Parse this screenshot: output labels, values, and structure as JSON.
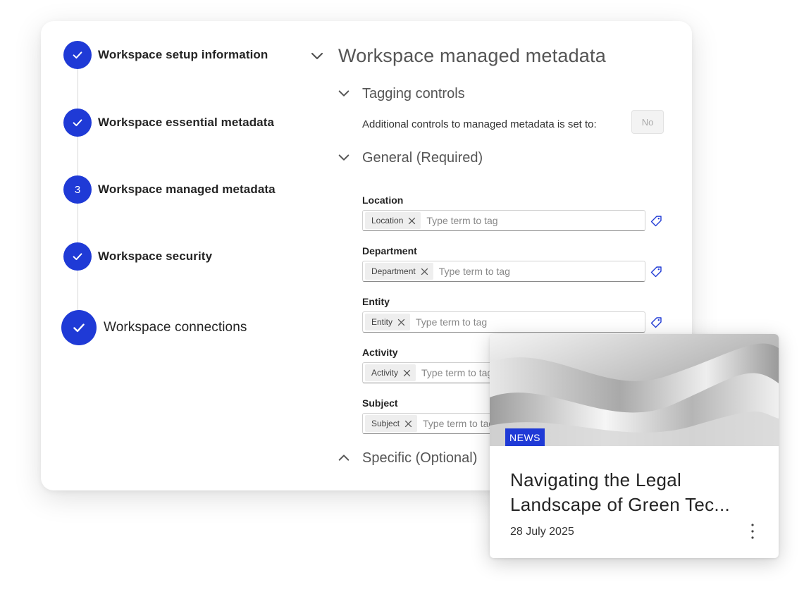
{
  "stepper": {
    "steps": [
      {
        "label": "Workspace setup information",
        "state": "complete",
        "icon": "check-icon"
      },
      {
        "label": "Workspace essential metadata",
        "state": "complete",
        "icon": "check-icon"
      },
      {
        "label": "Workspace managed metadata",
        "state": "current",
        "number": "3"
      },
      {
        "label": "Workspace security",
        "state": "complete",
        "icon": "check-icon"
      },
      {
        "label": "Workspace connections",
        "state": "complete",
        "icon": "check-icon"
      }
    ]
  },
  "main": {
    "title": "Workspace managed metadata",
    "tagging": {
      "heading": "Tagging controls",
      "description": "Additional controls to managed metadata is set to:",
      "toggle_value": "No"
    },
    "general": {
      "heading": "General (Required)",
      "fields": [
        {
          "label": "Location",
          "chip": "Location",
          "placeholder": "Type term to tag"
        },
        {
          "label": "Department",
          "chip": "Department",
          "placeholder": "Type term to tag"
        },
        {
          "label": "Entity",
          "chip": "Entity",
          "placeholder": "Type term to tag"
        },
        {
          "label": "Activity",
          "chip": "Activity",
          "placeholder": "Type term to tag"
        },
        {
          "label": "Subject",
          "chip": "Subject",
          "placeholder": "Type term to tag"
        }
      ]
    },
    "specific": {
      "heading": "Specific (Optional)"
    }
  },
  "news_card": {
    "badge": "NEWS",
    "title": "Navigating the Legal Landscape of Green Tec...",
    "date": "28 July 2025"
  },
  "colors": {
    "accent": "#1f3ad6",
    "text": "#242424",
    "muted": "#555555"
  }
}
